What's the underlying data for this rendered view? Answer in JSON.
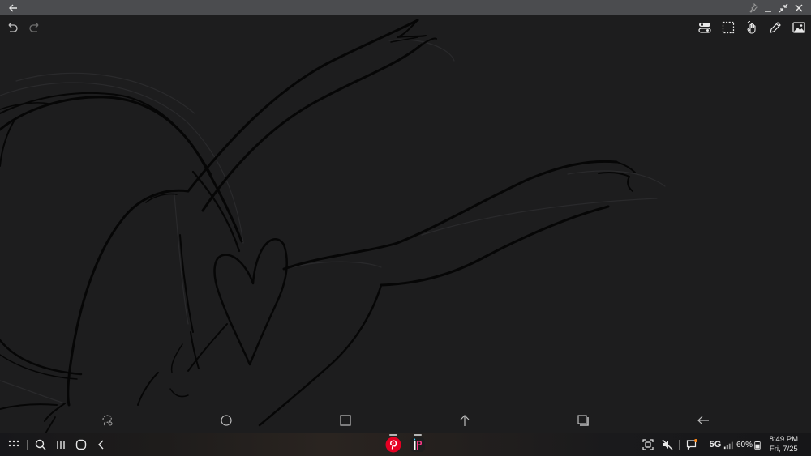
{
  "titlebar": {
    "icons": [
      "back-arrow-icon",
      "pin-icon",
      "minimize-icon",
      "shrink-icon",
      "close-icon"
    ]
  },
  "toolbar_top": {
    "left": [
      "undo-icon",
      "redo-icon"
    ],
    "right": [
      "toggle-icon",
      "selection-icon",
      "hand-touch-icon",
      "pen-icon",
      "image-icon"
    ]
  },
  "toolbar_bottom": [
    "lasso-icon",
    "circle-icon",
    "square-icon",
    "arrow-up-icon",
    "layers-icon",
    "arrow-left-icon"
  ],
  "taskbar": {
    "apps": [
      "pinterest-icon",
      "ibis-paint-icon"
    ],
    "network": "5G",
    "battery": "60%",
    "time": "8:49 PM",
    "date": "Fri, 7/25"
  },
  "colors": {
    "canvas": "#1d1d1e",
    "titlebar": "#4b4c4f",
    "stroke": "#000000",
    "pinterest": "#e60023"
  }
}
